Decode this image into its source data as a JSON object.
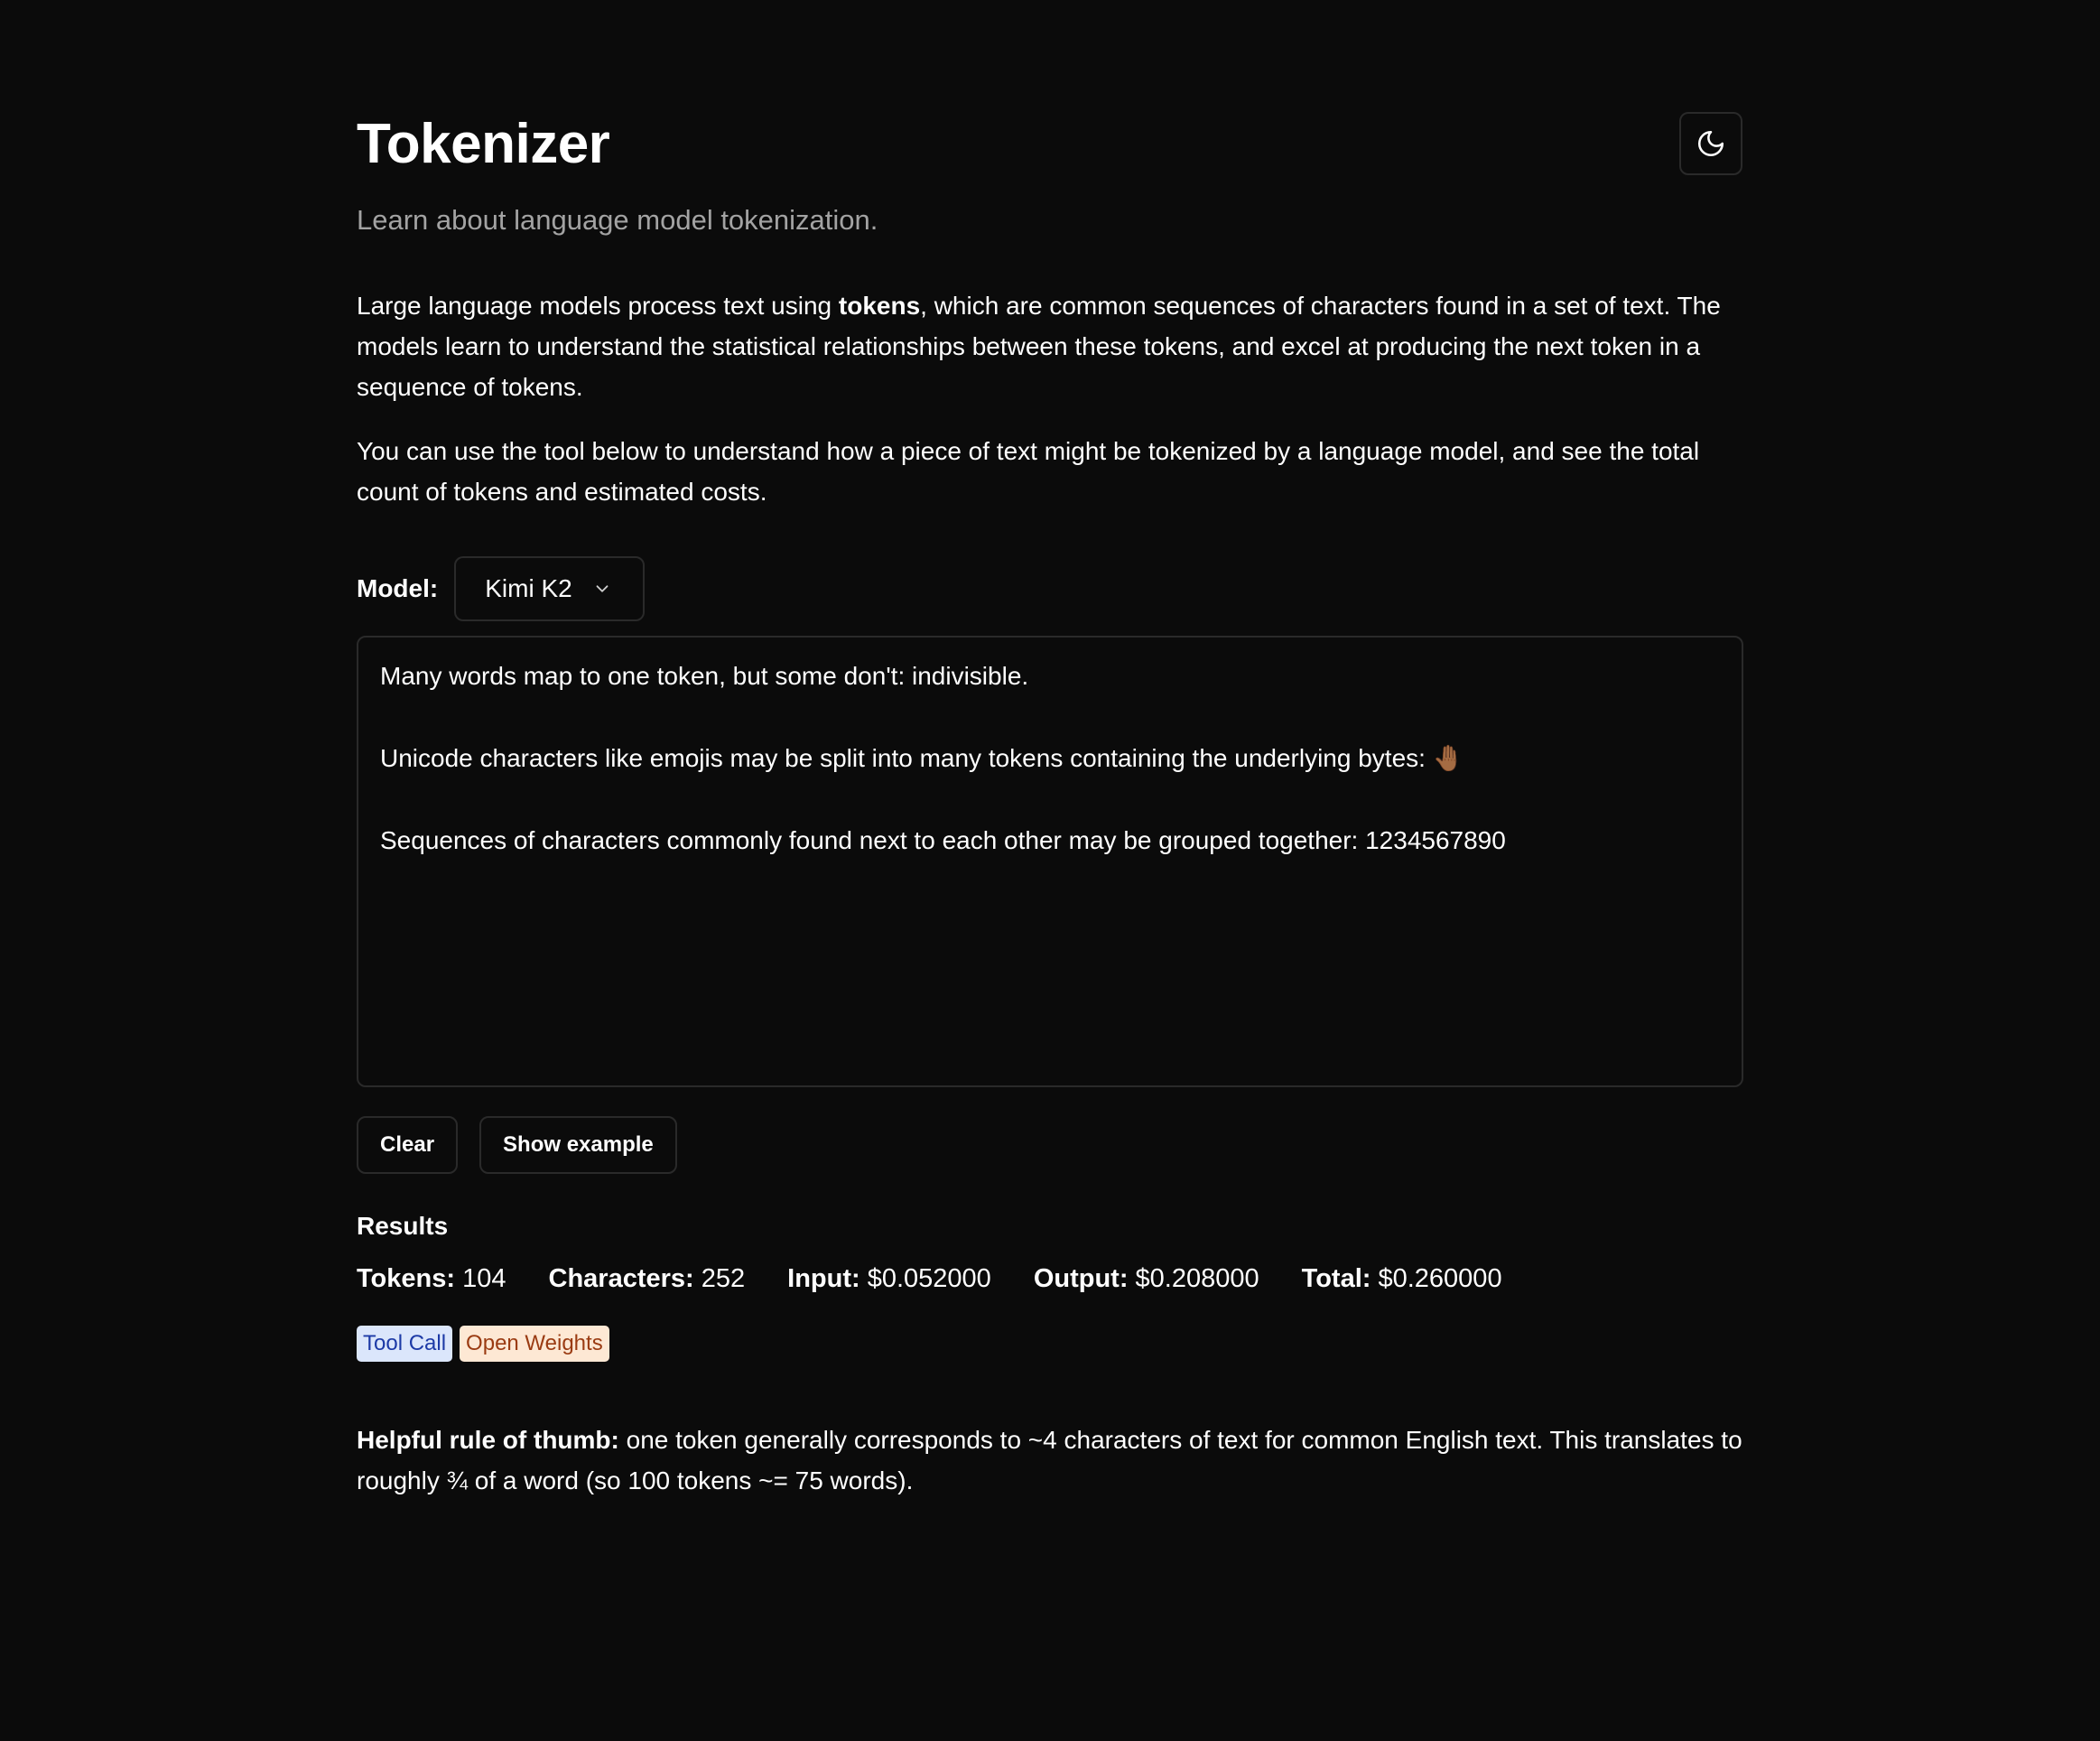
{
  "header": {
    "title": "Tokenizer",
    "subtitle": "Learn about language model tokenization."
  },
  "intro": {
    "p1_before": "Large language models process text using ",
    "p1_bold": "tokens",
    "p1_after": ", which are common sequences of characters found in a set of text. The models learn to understand the statistical relationships between these tokens, and excel at producing the next token in a sequence of tokens.",
    "p2": "You can use the tool below to understand how a piece of text might be tokenized by a language model, and see the total count of tokens and estimated costs."
  },
  "model": {
    "label": "Model:",
    "selected": "Kimi K2"
  },
  "input": {
    "text": "Many words map to one token, but some don't: indivisible.\n\nUnicode characters like emojis may be split into many tokens containing the underlying bytes: 🤚🏾\n\nSequences of characters commonly found next to each other may be grouped together: 1234567890"
  },
  "buttons": {
    "clear": "Clear",
    "show_example": "Show example"
  },
  "results": {
    "heading": "Results",
    "tokens_label": "Tokens:",
    "tokens_value": "104",
    "characters_label": "Characters:",
    "characters_value": "252",
    "input_label": "Input:",
    "input_value": "$0.052000",
    "output_label": "Output:",
    "output_value": "$0.208000",
    "total_label": "Total:",
    "total_value": "$0.260000"
  },
  "tags": {
    "tool_call": "Tool Call",
    "open_weights": "Open Weights"
  },
  "tip": {
    "bold": "Helpful rule of thumb:",
    "text": " one token generally corresponds to ~4 characters of text for common English text. This translates to roughly ¾ of a word (so 100 tokens ~= 75 words)."
  },
  "icons": {
    "theme_toggle": "moon-icon",
    "select_caret": "chevron-down-icon"
  },
  "colors": {
    "background": "#0b0b0b",
    "text": "#ffffff",
    "muted": "#a3a3a3",
    "border": "#2a2a2a",
    "tag_tool_bg": "#dbe6fb",
    "tag_tool_fg": "#1d3aa6",
    "tag_open_bg": "#fde8d4",
    "tag_open_fg": "#9a3b12"
  }
}
